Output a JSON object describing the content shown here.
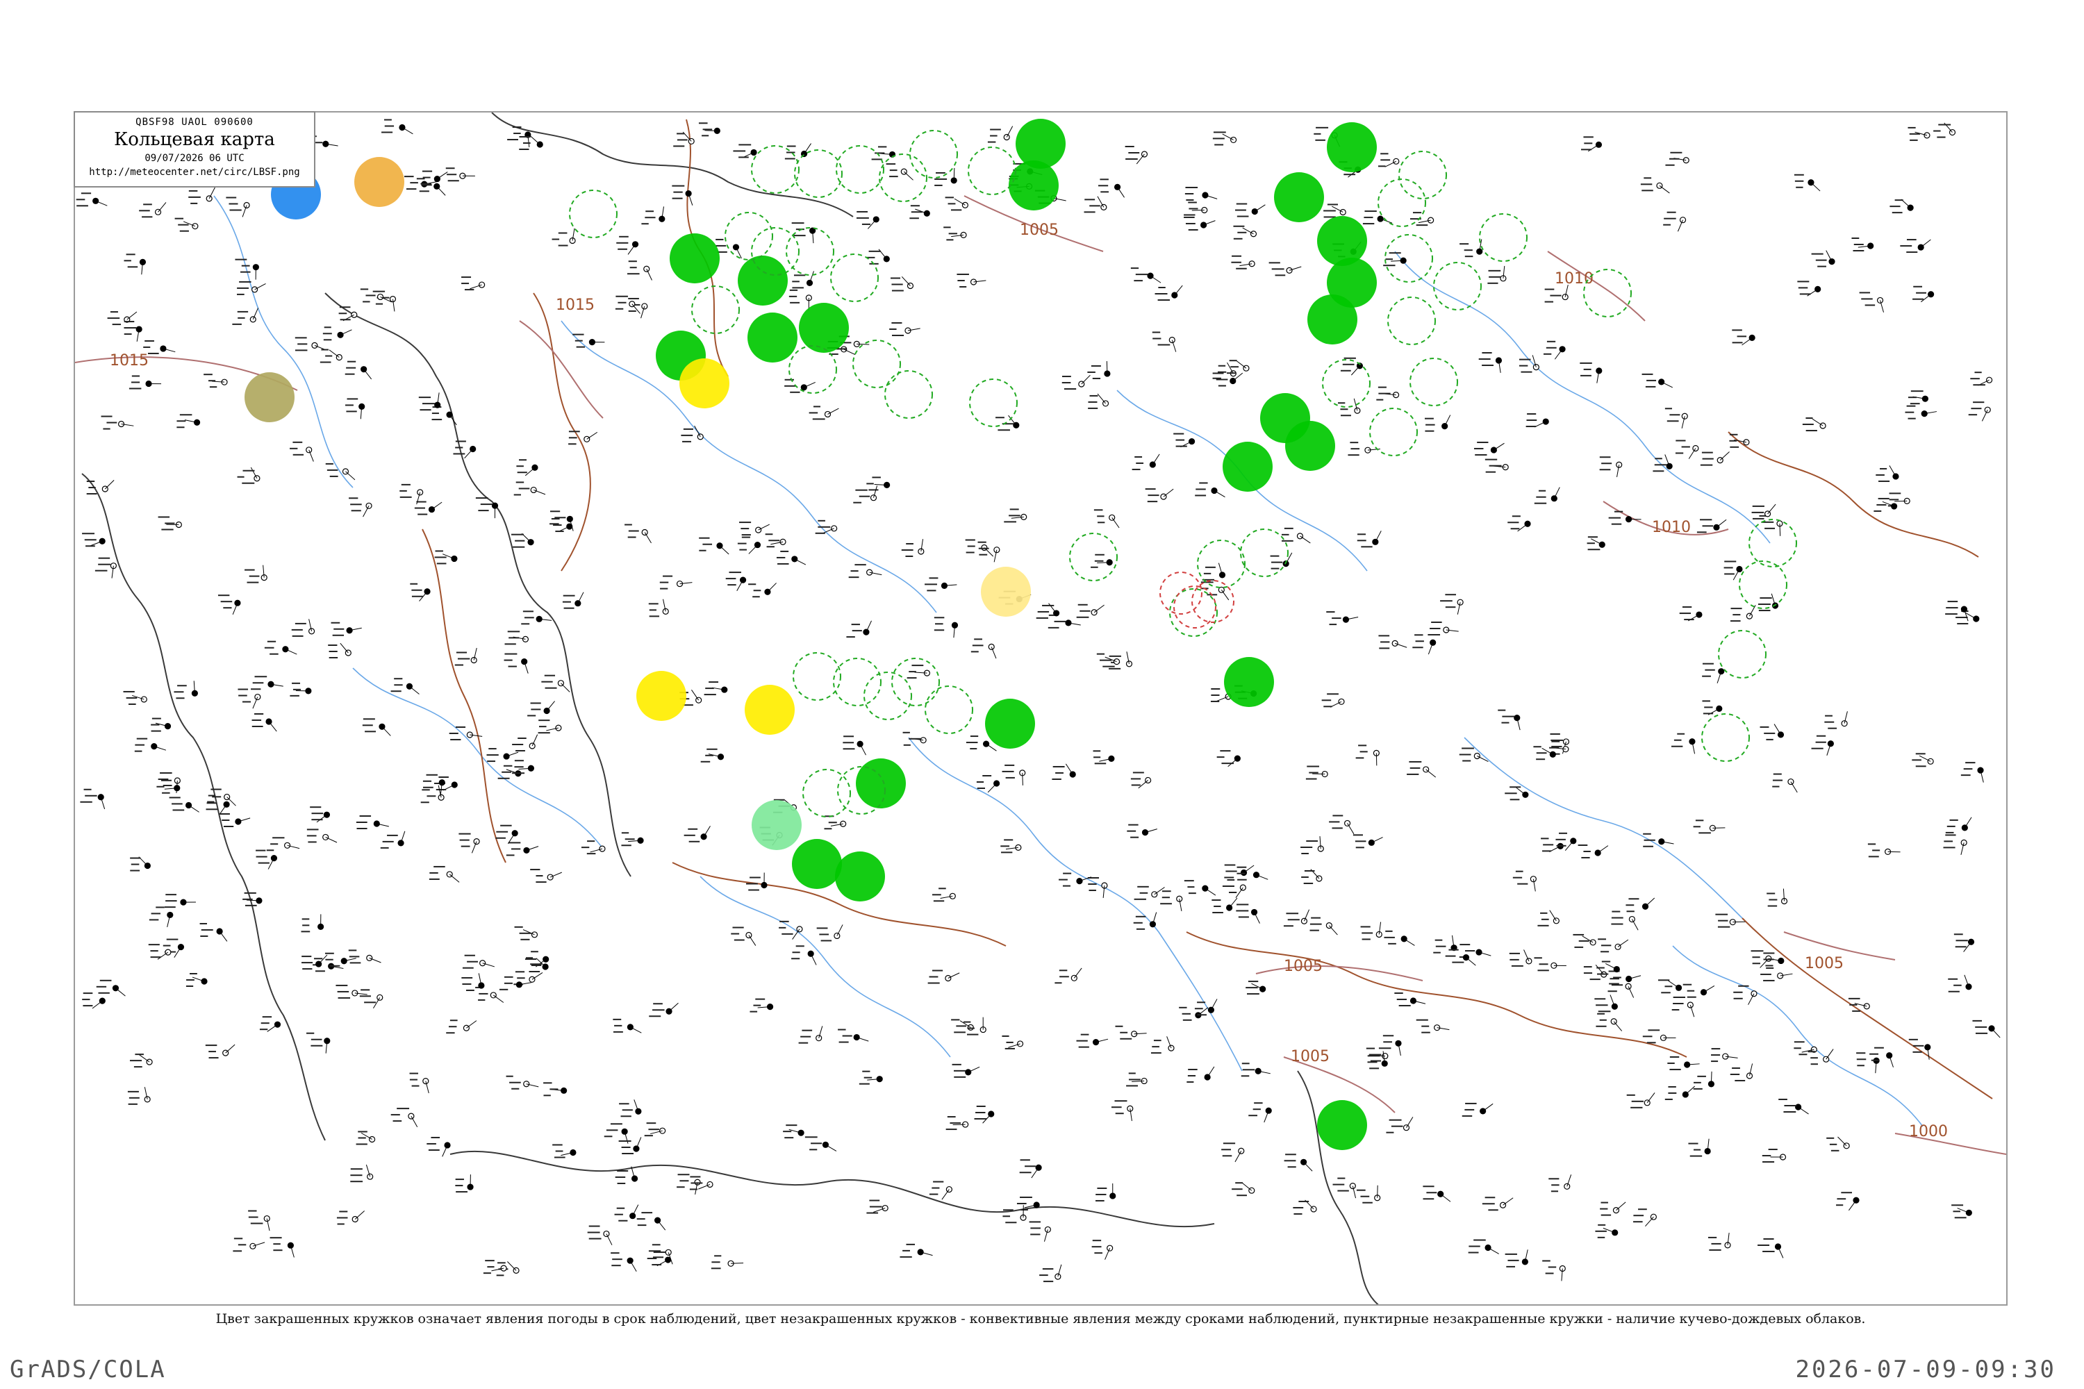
{
  "legend": {
    "header": "QBSF98  UAOL  090600",
    "title": "Кольцевая карта",
    "datetime": "09/07/2026 06 UTC",
    "url": "http://meteocenter.net/circ/LBSF.png"
  },
  "caption": "Цвет закрашенных кружков означает явления погоды в срок наблюдений, цвет незакрашенных кружков - конвективные явления между сроками наблюдений, пунктирные незакрашенные кружки - наличие кучево-дождевых облаков.",
  "footer": {
    "left": "GrADS/COLA",
    "right": "2026-07-09-09:30"
  },
  "isobars": [
    {
      "label": "1015"
    },
    {
      "label": "1015"
    },
    {
      "label": "1005"
    },
    {
      "label": "1010"
    },
    {
      "label": "1010"
    },
    {
      "label": "1005"
    },
    {
      "label": "1005"
    },
    {
      "label": "1005"
    },
    {
      "label": "1000"
    }
  ],
  "colors": {
    "rain": "#00c800",
    "shower_ring": "#22aa22",
    "haze": "#ffee00",
    "fog": "#ffe98a",
    "drizzle": "#2288ee",
    "dust": "#f0b040",
    "mist": "#b0a860",
    "light_rain": "#7fe89a",
    "river": "#6aa8e8",
    "border": "#a0522d",
    "coast": "#404040"
  }
}
